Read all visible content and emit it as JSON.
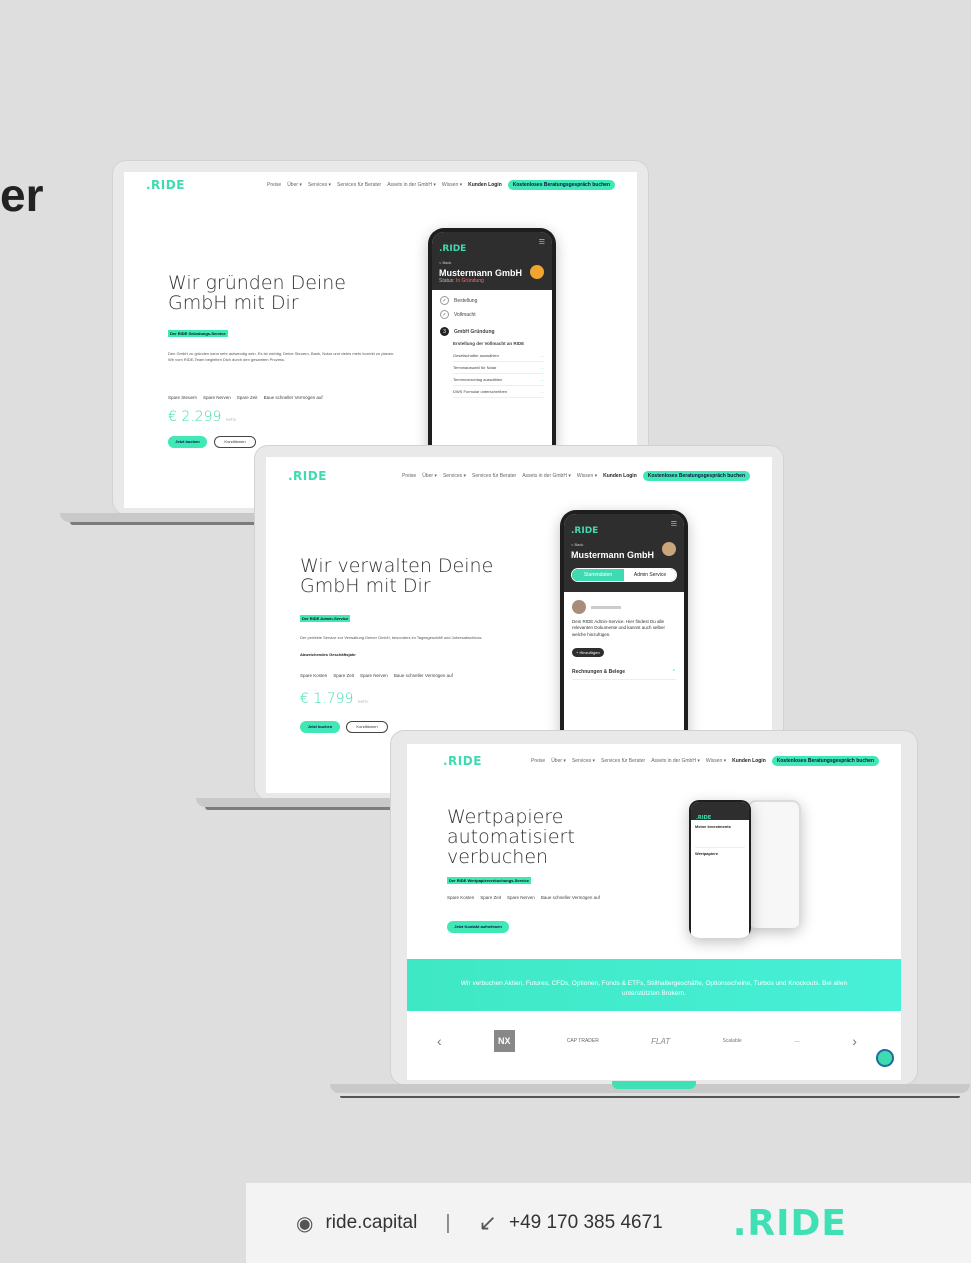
{
  "heading_fragment": "er",
  "nav": {
    "logo": ".RIDE",
    "items": [
      "Preise",
      "Über ▾",
      "Services ▾",
      "Services für Berater",
      "Assets in der GmbH ▾",
      "Wissen ▾"
    ],
    "login": "Kunden Login",
    "cta": "Kostenloses Beratungsgespräch buchen"
  },
  "laptop1": {
    "title": "Wir gründen Deine GmbH mit Dir",
    "tag": "Der RIDE Gründungs-Service",
    "text": "Den GmbH zu gründen kann sehr aufwendig sein. Es ist wichtig, Deine Steuern, Bank, Notar und vieles mehr korrekt zu planen. Wir vom RIDE-Team begleiten Dich durch den gesamten Prozess.",
    "features": [
      "Spare Steuern",
      "Spare Nerven",
      "Spare Zeit",
      "Baue schneller Vermögen auf"
    ],
    "price": "€ 2.299",
    "price_suffix": "netto",
    "btn_primary": "Jetzt buchen",
    "btn_secondary": "Konditionen",
    "phone": {
      "logo": ".RIDE",
      "back": "< Back",
      "company": "Mustermann GmbH",
      "status_label": "Status:",
      "status_value": "In Gründung",
      "steps": [
        "Bestellung",
        "Vollmacht"
      ],
      "current_step": "GmbH Gründung",
      "current_sub": "Erstellung der Vollmacht an RIDE",
      "tasks": [
        "Gesellschafter auswählen",
        "Terminauswahl für Notar",
        "Terminvorschlag auswählen",
        "DWS Formular unterschreiben"
      ]
    }
  },
  "laptop2": {
    "title": "Wir verwalten Deine GmbH mit Dir",
    "tag": "Der RIDE Admin-Service",
    "text": "Der perfekte Service zur Verwaltung Deiner GmbH, besonders im Tagesgeschäft und Jahresabschluss.",
    "text_bold": "Abweichendes Geschäftsjahr",
    "features": [
      "Spare Kosten",
      "Spare Zeit",
      "Spare Nerven",
      "Baue schneller Vermögen auf"
    ],
    "price": "€ 1.799",
    "price_suffix": "netto",
    "btn_primary": "Jetzt buchen",
    "btn_secondary": "Konditionen",
    "phone": {
      "logo": ".RIDE",
      "back": "< Back",
      "company": "Mustermann GmbH",
      "toggle_a": "Stammdaten",
      "toggle_b": "Admin Service",
      "message": "Dein RIDE Admin-Service. Hier findest Du alle relevanten Dokumente und kannst auch selber welche hinzufügen.",
      "add_btn": "+ Hinzufügen",
      "section": "Rechnungen & Belege"
    }
  },
  "laptop3": {
    "title": "Wertpapiere automatisiert verbuchen",
    "tag": "Der RIDE Wertpapierverbuchungs-Service",
    "features": [
      "Spare Kosten",
      "Spare Zeit",
      "Spare Nerven",
      "Baue schneller Vermögen auf"
    ],
    "btn_primary": "Jetzt Kontakt aufnehmen",
    "banner": "Wir verbuchen Aktien, Futures, CFDs, Optionen, Fonds & ETFs, Stillhaltergeschäfte, Optionsscheine, Turbos und Knockouts. Bei allen unterstützten Brokern.",
    "partners": [
      "NX",
      "CAP TRADER",
      "FLAT",
      "Scalable",
      "…"
    ],
    "phone": {
      "title": "Meine Investments",
      "section": "Wertpapiere"
    }
  },
  "footer": {
    "website": "ride.capital",
    "separator": "|",
    "phone": "+49 170 385 4671",
    "logo": ".RIDE"
  }
}
